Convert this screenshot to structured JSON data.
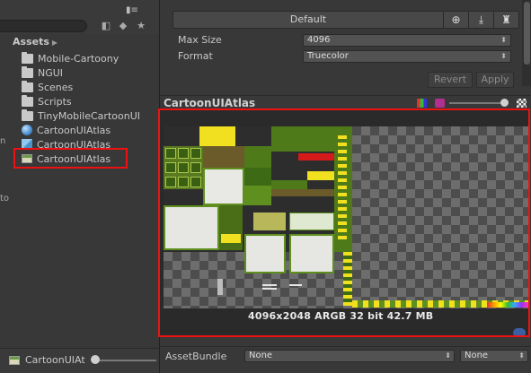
{
  "project": {
    "assets_header": "Assets",
    "items": [
      {
        "label": "Mobile-Cartoony",
        "kind": "folder"
      },
      {
        "label": "NGUI",
        "kind": "folder"
      },
      {
        "label": "Scenes",
        "kind": "folder"
      },
      {
        "label": "Scripts",
        "kind": "folder"
      },
      {
        "label": "TinyMobileCartoonUI",
        "kind": "folder"
      },
      {
        "label": "CartoonUIAtlas",
        "kind": "material"
      },
      {
        "label": "CartoonUIAtlas",
        "kind": "prefab"
      },
      {
        "label": "CartoonUIAtlas",
        "kind": "texture",
        "selected": true
      }
    ],
    "bottom_selection": "CartoonUIAt",
    "left_edge_chars": [
      "n",
      "to"
    ]
  },
  "importer": {
    "platform_tab": "Default",
    "platform_icons": [
      "globe-icon",
      "download-icon",
      "android-icon"
    ],
    "max_size_label": "Max Size",
    "max_size_value": "4096",
    "format_label": "Format",
    "format_value": "Truecolor",
    "revert_label": "Revert",
    "apply_label": "Apply"
  },
  "preview": {
    "title": "CartoonUIAtlas",
    "info": "4096x2048  ARGB 32 bit  42.7 MB"
  },
  "asset_bundle": {
    "label": "AssetBundle",
    "name_value": "None",
    "variant_value": "None"
  },
  "colors": {
    "highlight": "#ee1111",
    "panel": "#383838",
    "atlas_green": "#5f8f1f",
    "atlas_yellow": "#f0e020"
  }
}
